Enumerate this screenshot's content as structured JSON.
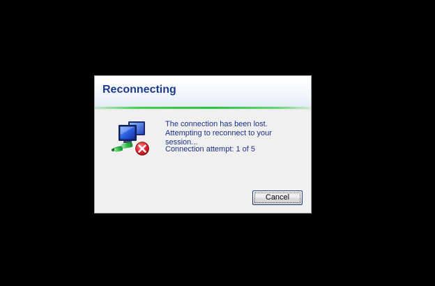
{
  "dialog": {
    "title": "Reconnecting",
    "message": "The connection has been lost. Attempting to reconnect to your session...",
    "attempt_text": "Connection attempt: 1 of 5",
    "cancel_label": "Cancel",
    "icon": "network-disconnected-icon"
  },
  "colors": {
    "desktop": "#000000",
    "dialog_bg": "#f0f0f0",
    "title": "#1c3a8c",
    "text": "#1c2f86",
    "progress": "#2fc046",
    "error": "#d9262e"
  }
}
